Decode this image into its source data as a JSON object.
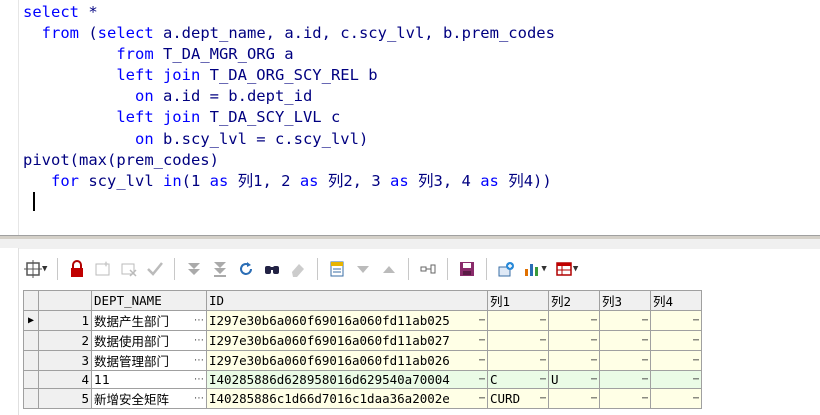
{
  "editor": {
    "lines": [
      [
        {
          "t": "select",
          "k": true
        },
        {
          "t": " *",
          "k": false
        }
      ],
      [
        {
          "t": "  from",
          "k": true
        },
        {
          "t": " (",
          "k": false
        },
        {
          "t": "select",
          "k": true
        },
        {
          "t": " a.dept_name, a.id, c.scy_lvl, b.prem_codes",
          "k": false
        }
      ],
      [
        {
          "t": "          from",
          "k": true
        },
        {
          "t": " T_DA_MGR_ORG a",
          "k": false
        }
      ],
      [
        {
          "t": "          left join",
          "k": true
        },
        {
          "t": " T_DA_ORG_SCY_REL b",
          "k": false
        }
      ],
      [
        {
          "t": "            on",
          "k": true
        },
        {
          "t": " a.id = b.dept_id",
          "k": false
        }
      ],
      [
        {
          "t": "          left join",
          "k": true
        },
        {
          "t": " T_DA_SCY_LVL c",
          "k": false
        }
      ],
      [
        {
          "t": "            on",
          "k": true
        },
        {
          "t": " b.scy_lvl = c.scy_lvl)",
          "k": false
        }
      ],
      [
        {
          "t": "pivot(max(prem_codes)",
          "k": false
        }
      ],
      [
        {
          "t": "   for",
          "k": true
        },
        {
          "t": " scy_lvl ",
          "k": false
        },
        {
          "t": "in",
          "k": true
        },
        {
          "t": "(1 ",
          "k": false
        },
        {
          "t": "as",
          "k": true
        },
        {
          "t": " 列1, 2 ",
          "k": false
        },
        {
          "t": "as",
          "k": true
        },
        {
          "t": " 列2, 3 ",
          "k": false
        },
        {
          "t": "as",
          "k": true
        },
        {
          "t": " 列3, 4 ",
          "k": false
        },
        {
          "t": "as",
          "k": true
        },
        {
          "t": " 列4))",
          "k": false
        }
      ]
    ]
  },
  "toolbar": {
    "icons": [
      "filter-icon",
      "lock-icon",
      "add-record-icon",
      "delete-record-icon",
      "post-icon",
      "fetch-next-icon",
      "fetch-last-icon",
      "refresh-icon",
      "find-icon",
      "clear-icon",
      "query-by-example-icon",
      "sort-desc-icon",
      "sort-asc-icon",
      "export-icon",
      "save-icon",
      "link-icon",
      "chart-icon",
      "grid-view-icon"
    ]
  },
  "grid": {
    "headers": [
      "DEPT_NAME",
      "ID",
      "列1",
      "列2",
      "列3",
      "列4"
    ],
    "rows": [
      {
        "n": "1",
        "name": "数据产生部门",
        "id": "I297e30b6a060f69016a060fd11ab025",
        "c1": "",
        "c2": "",
        "c3": "",
        "c4": ""
      },
      {
        "n": "2",
        "name": "数据使用部门",
        "id": "I297e30b6a060f69016a060fd11ab027",
        "c1": "",
        "c2": "",
        "c3": "",
        "c4": ""
      },
      {
        "n": "3",
        "name": "数据管理部门",
        "id": "I297e30b6a060f69016a060fd11ab026",
        "c1": "",
        "c2": "",
        "c3": "",
        "c4": ""
      },
      {
        "n": "4",
        "name": "11",
        "id": "I40285886d628958016d629540a70004",
        "c1": "C",
        "c2": "U",
        "c3": "",
        "c4": ""
      },
      {
        "n": "5",
        "name": "新增安全矩阵",
        "id": "I40285886c1d66d7016c1daa36a2002e",
        "c1": "CURD",
        "c2": "",
        "c3": "",
        "c4": ""
      }
    ]
  }
}
